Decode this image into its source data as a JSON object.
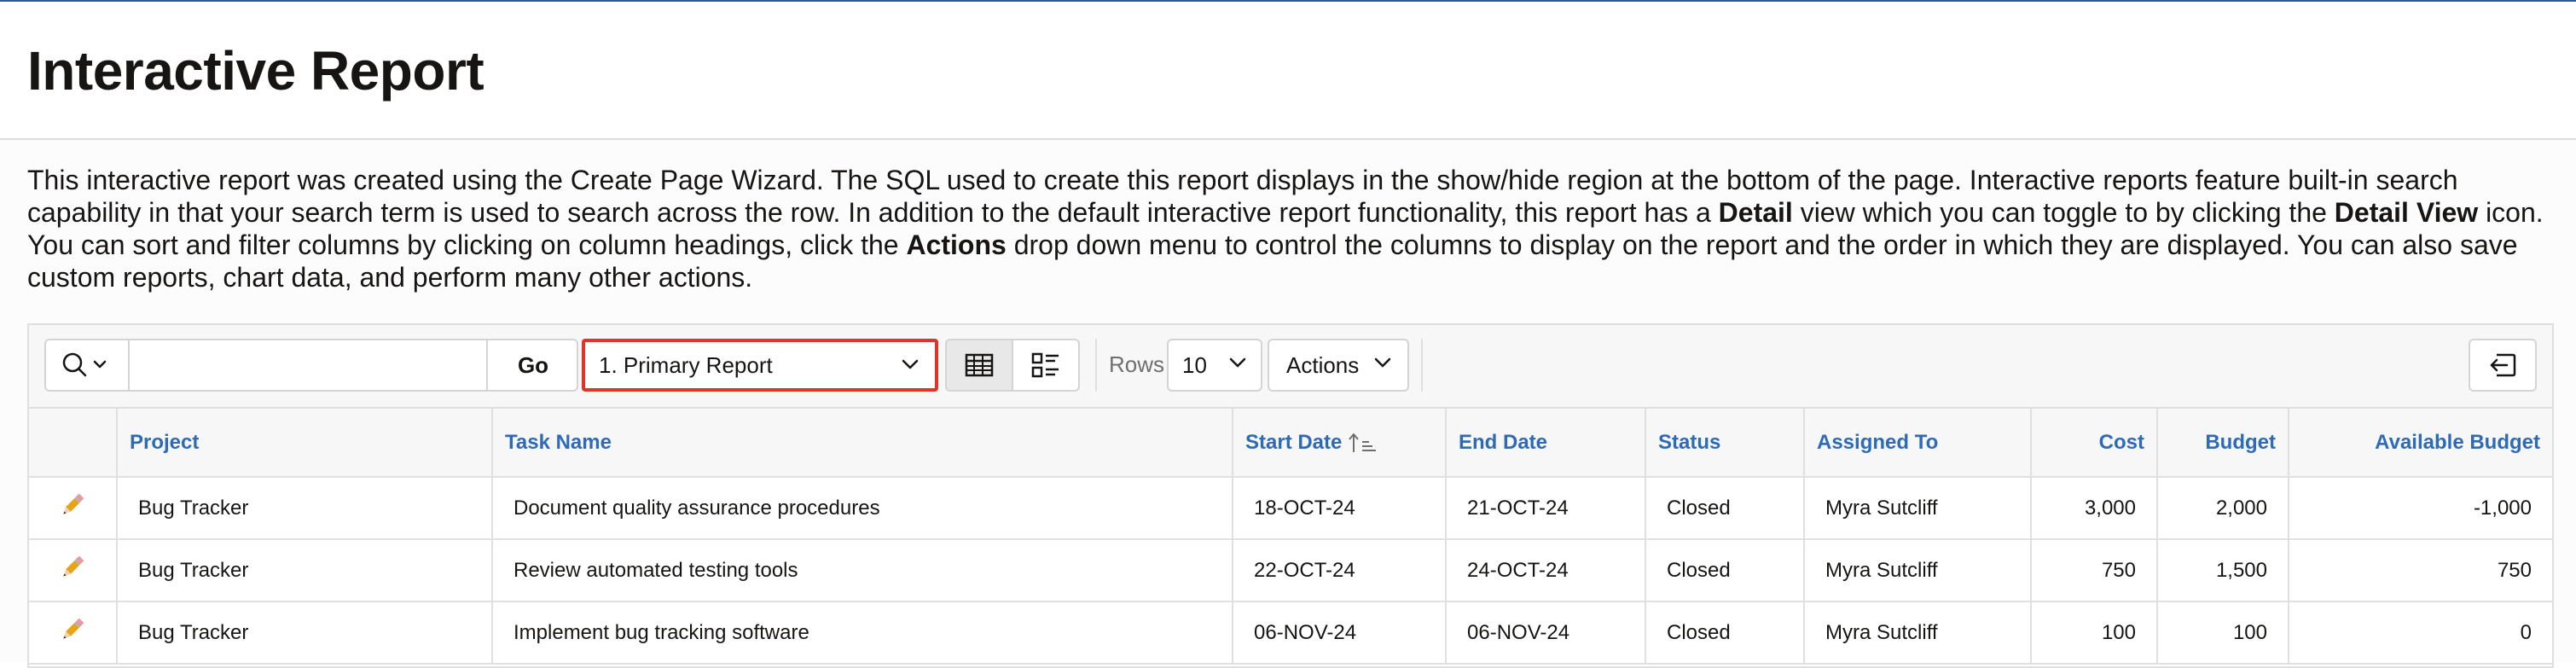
{
  "page": {
    "title": "Interactive Report",
    "description": {
      "part1": "This interactive report was created using the Create Page Wizard. The SQL used to create this report displays in the show/hide region at the bottom of the page. Interactive reports feature built-in search capability in that your search term is used to search across the row. In addition to the default interactive report functionality, this report has a ",
      "bold1": "Detail",
      "part2": " view which you can toggle to by clicking the ",
      "bold2": "Detail View",
      "part3": " icon. You can sort and filter columns by clicking on column headings, click the ",
      "bold3": "Actions",
      "part4": " drop down menu to control the columns to display on the report and the order in which they are displayed. You can also save custom reports, chart data, and perform many other actions."
    }
  },
  "toolbar": {
    "search_icon": "search-icon",
    "search_value": "",
    "go_label": "Go",
    "report_selected": "1. Primary Report",
    "grid_view_icon": "grid-view-icon",
    "detail_view_icon": "detail-view-icon",
    "rows_label": "Rows",
    "rows_value": "10",
    "actions_label": "Actions",
    "reset_icon": "reset-icon"
  },
  "table": {
    "columns": [
      "Project",
      "Task Name",
      "Start Date",
      "End Date",
      "Status",
      "Assigned To",
      "Cost",
      "Budget",
      "Available Budget"
    ],
    "sorted_column": "Start Date",
    "sort_direction": "ascending",
    "rows": [
      {
        "project": "Bug Tracker",
        "task": "Document quality assurance procedures",
        "start": "18-OCT-24",
        "end": "21-OCT-24",
        "status": "Closed",
        "assigned": "Myra Sutcliff",
        "cost": "3,000",
        "budget": "2,000",
        "available": "-1,000"
      },
      {
        "project": "Bug Tracker",
        "task": "Review automated testing tools",
        "start": "22-OCT-24",
        "end": "24-OCT-24",
        "status": "Closed",
        "assigned": "Myra Sutcliff",
        "cost": "750",
        "budget": "1,500",
        "available": "750"
      },
      {
        "project": "Bug Tracker",
        "task": "Implement bug tracking software",
        "start": "06-NOV-24",
        "end": "06-NOV-24",
        "status": "Closed",
        "assigned": "Myra Sutcliff",
        "cost": "100",
        "budget": "100",
        "available": "0"
      }
    ]
  },
  "colors": {
    "header_link": "#2d6ab8",
    "highlight_border": "#e0342b",
    "edit_icon": "#e8a317"
  }
}
